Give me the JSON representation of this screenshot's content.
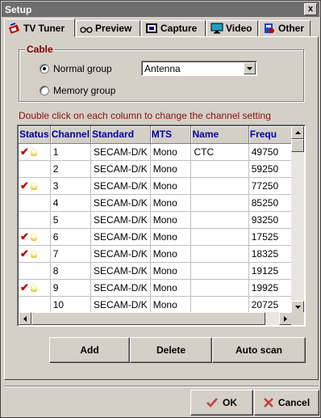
{
  "window": {
    "title": "Setup",
    "close_symbol": "x"
  },
  "tabs": [
    {
      "label": "TV Tuner",
      "icon": "tv-tuner-icon",
      "active": true
    },
    {
      "label": "Preview",
      "icon": "preview-icon",
      "active": false
    },
    {
      "label": "Capture",
      "icon": "capture-icon",
      "active": false
    },
    {
      "label": "Video",
      "icon": "video-icon",
      "active": false
    },
    {
      "label": "Other",
      "icon": "other-icon",
      "active": false
    }
  ],
  "cable": {
    "title": "Cable",
    "normal_group_label": "Normal group",
    "memory_group_label": "Memory group",
    "selected": "Normal group",
    "group_select_value": "Antenna"
  },
  "hint": "Double click on each column to change the channel setting",
  "table": {
    "columns": [
      "Status",
      "Channel",
      "Standard",
      "MTS",
      "Name",
      "Frequ"
    ],
    "rows": [
      {
        "status": true,
        "channel": "1",
        "standard": "SECAM-D/K",
        "mts": "Mono",
        "name": "CTC",
        "freq": "49750"
      },
      {
        "status": false,
        "channel": "2",
        "standard": "SECAM-D/K",
        "mts": "Mono",
        "name": "",
        "freq": "59250"
      },
      {
        "status": true,
        "channel": "3",
        "standard": "SECAM-D/K",
        "mts": "Mono",
        "name": "",
        "freq": "77250"
      },
      {
        "status": false,
        "channel": "4",
        "standard": "SECAM-D/K",
        "mts": "Mono",
        "name": "",
        "freq": "85250"
      },
      {
        "status": false,
        "channel": "5",
        "standard": "SECAM-D/K",
        "mts": "Mono",
        "name": "",
        "freq": "93250"
      },
      {
        "status": true,
        "channel": "6",
        "standard": "SECAM-D/K",
        "mts": "Mono",
        "name": "",
        "freq": "17525"
      },
      {
        "status": true,
        "channel": "7",
        "standard": "SECAM-D/K",
        "mts": "Mono",
        "name": "",
        "freq": "18325"
      },
      {
        "status": false,
        "channel": "8",
        "standard": "SECAM-D/K",
        "mts": "Mono",
        "name": "",
        "freq": "19125"
      },
      {
        "status": true,
        "channel": "9",
        "standard": "SECAM-D/K",
        "mts": "Mono",
        "name": "",
        "freq": "19925"
      },
      {
        "status": false,
        "channel": "10",
        "standard": "SECAM-D/K",
        "mts": "Mono",
        "name": "",
        "freq": "20725"
      }
    ],
    "status_icons": [
      "checkmark-icon",
      "lightbulb-icon"
    ]
  },
  "actions": {
    "add": "Add",
    "delete": "Delete",
    "auto_scan": "Auto scan"
  },
  "footer": {
    "ok": "OK",
    "cancel": "Cancel"
  },
  "colors": {
    "accent_text": "#0000a0",
    "hint_red": "#8b1010",
    "check_red": "#c00000",
    "title_gray": "#6e6e6e"
  }
}
